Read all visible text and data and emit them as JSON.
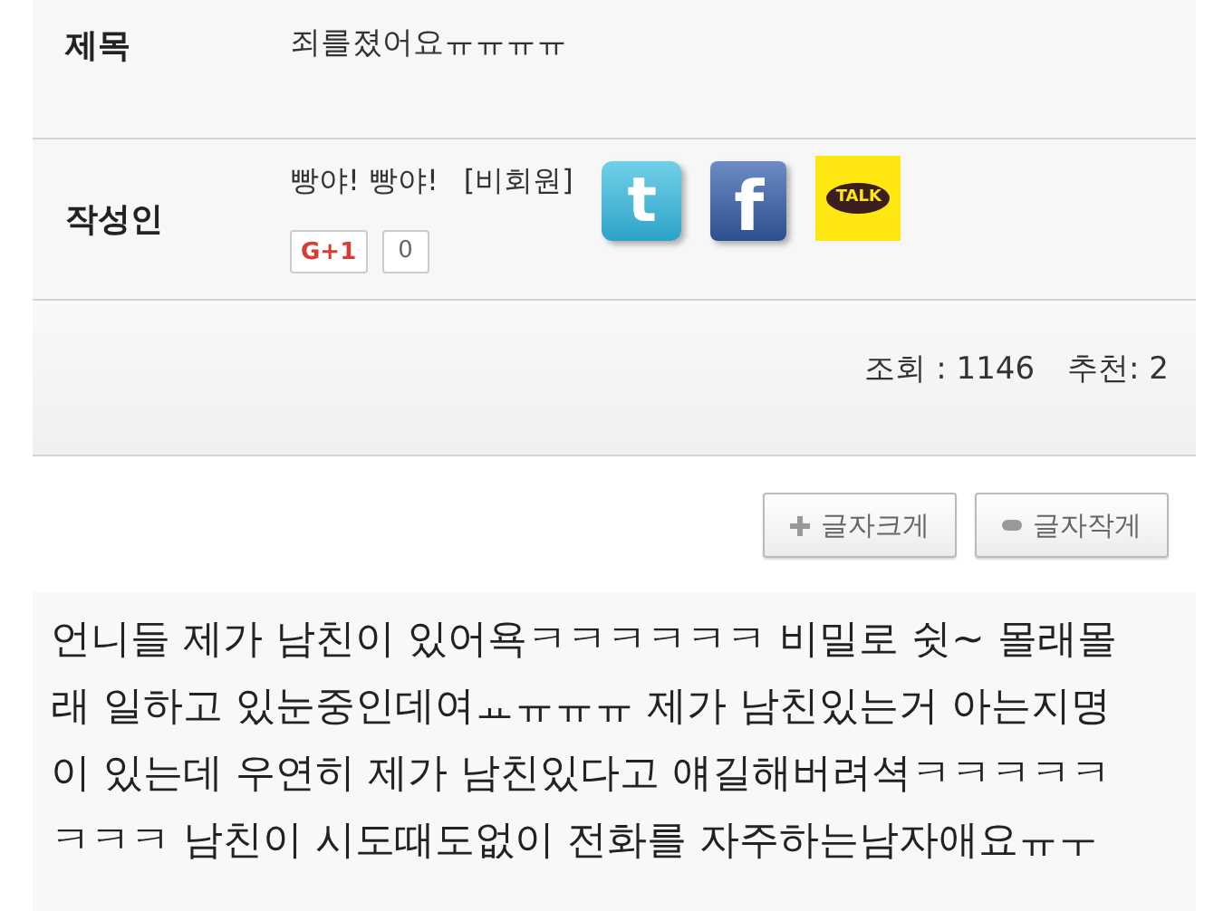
{
  "title_row": {
    "label": "제목",
    "value": "죄를졌어요ㅠㅠㅠㅠ"
  },
  "author_row": {
    "label": "작성인",
    "name": "빵야! 빵야!",
    "member_tag": "[비회원]",
    "share_icons": [
      {
        "kind": "twitter",
        "glyph": "t"
      },
      {
        "kind": "facebook",
        "glyph": "f"
      },
      {
        "kind": "kakaotalk",
        "glyph": "TALK"
      }
    ],
    "plusone": {
      "label": "G+1",
      "count": "0"
    }
  },
  "stats": {
    "views": "조회 : 1146",
    "recommends": "추천: 2"
  },
  "font_buttons": [
    {
      "kind": "plus",
      "label": "글자크게"
    },
    {
      "kind": "minus",
      "label": "글자작게"
    }
  ],
  "body_lines": [
    "언니들 제가 남친이 있어욕ㅋㅋㅋㅋㅋㅋ 비밀로 쉿~ 몰래몰",
    "래 일하고 있눈중인데여ㅛㅠㅠㅠ 제가 남친있는거 아는지명",
    "이 있는데 우연히 제가 남친있다고 얘길해버려셕ㅋㅋㅋㅋㅋ",
    "ㅋㅋㅋ 남친이 시도때도없이 전화를 자주하는남자애요ㅠㅜ"
  ]
}
